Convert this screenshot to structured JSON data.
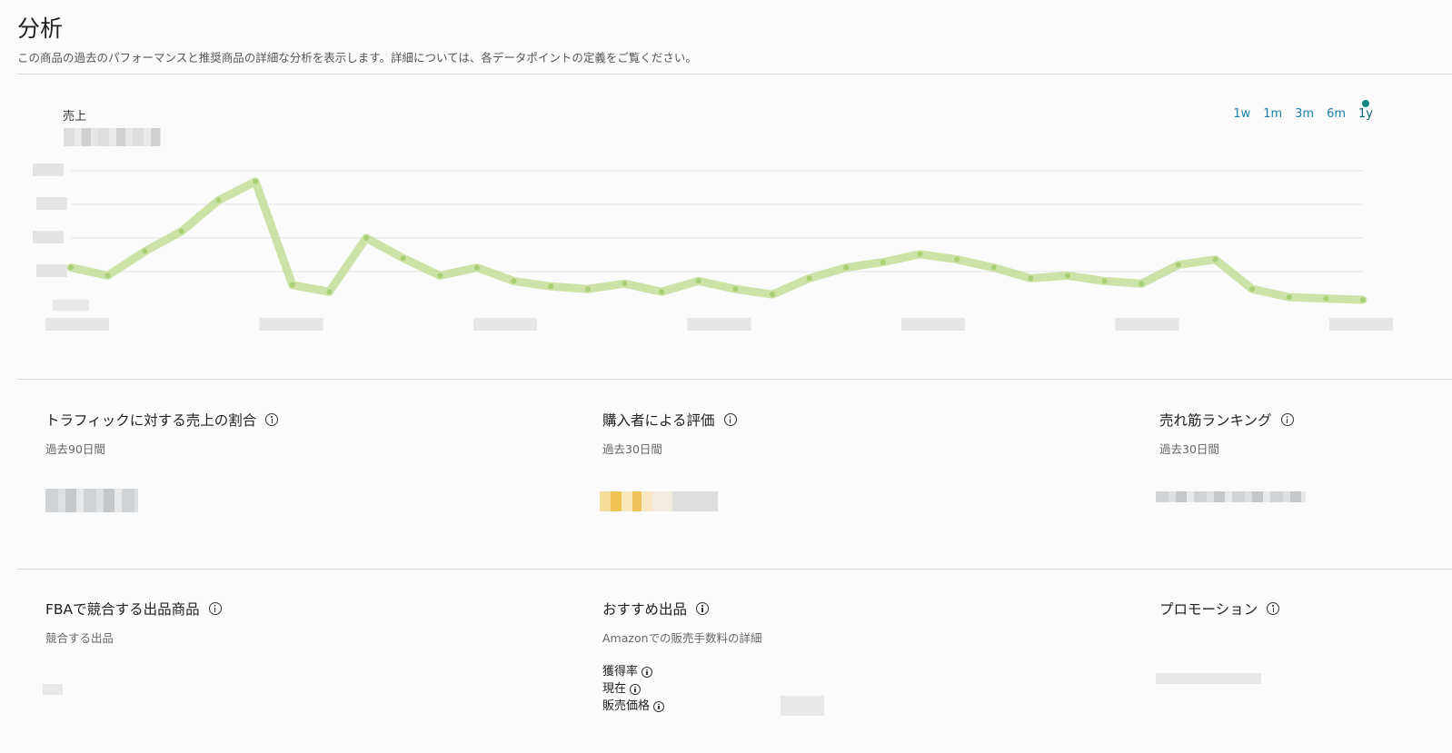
{
  "header": {
    "title": "分析",
    "description": "この商品の過去のパフォーマンスと推奨商品の詳細な分析を表示します。詳細については、各データポイントの定義をご覧ください。"
  },
  "sales_chart": {
    "title": "売上",
    "ranges": [
      "1w",
      "1m",
      "3m",
      "6m",
      "1y"
    ],
    "active_range": "1y",
    "colors": {
      "series": "#c3dd97",
      "grid": "#e3e3e3",
      "accent": "#0f8a83",
      "tab": "#1b7fa8"
    }
  },
  "chart_data": {
    "type": "line",
    "title": "",
    "xlabel": "",
    "ylabel": "",
    "grid": true,
    "ylim": [
      0,
      100
    ],
    "series": [
      {
        "values": [
          28,
          22,
          40,
          55,
          78,
          92,
          15,
          10,
          50,
          35,
          22,
          28,
          18,
          14,
          12,
          16,
          10,
          18,
          12,
          8,
          20,
          28,
          32,
          38,
          34,
          28,
          20,
          22,
          18,
          16,
          30,
          34,
          12,
          6,
          5,
          4
        ]
      }
    ]
  },
  "metrics": {
    "traffic": {
      "title": "トラフィックに対する売上の割合",
      "period": "過去90日間"
    },
    "rating": {
      "title": "購入者による評価",
      "period": "過去30日間"
    },
    "bestseller": {
      "title": "売れ筋ランキング",
      "period": "過去30日間"
    },
    "fba": {
      "title": "FBAで競合する出品商品",
      "sub": "競合する出品"
    },
    "featured": {
      "title": "おすすめ出品",
      "sub": "Amazonでの販売手数料の詳細",
      "rows": [
        {
          "label": "獲得率"
        },
        {
          "label": "現在"
        },
        {
          "label": "販売価格"
        }
      ]
    },
    "promotion": {
      "title": "プロモーション"
    }
  }
}
